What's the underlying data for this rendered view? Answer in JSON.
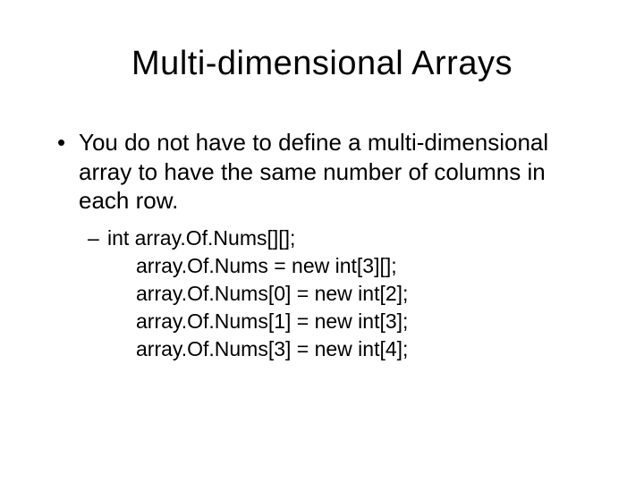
{
  "title": "Multi-dimensional Arrays",
  "bullet1": {
    "marker": "•",
    "text": "You do not have to define a multi-dimensional array to have the same number of columns in each row."
  },
  "bullet2": {
    "marker": "–",
    "line0": "int array.Of.Nums[][];",
    "line1": "array.Of.Nums = new int[3][];",
    "line2": "array.Of.Nums[0] = new int[2];",
    "line3": "array.Of.Nums[1] = new int[3];",
    "line4": "array.Of.Nums[3] = new int[4];"
  }
}
